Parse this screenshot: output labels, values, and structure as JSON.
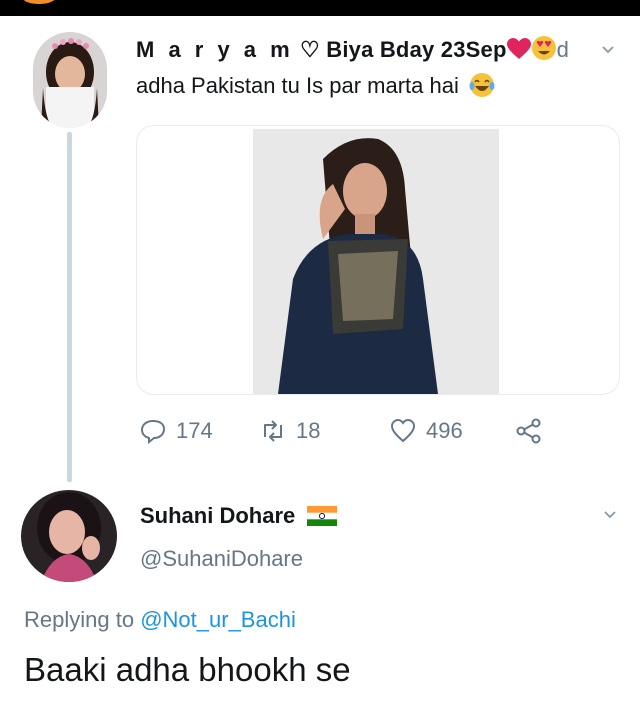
{
  "tweet": {
    "author_spaced": "M a r y a m",
    "author_rest": "♡ Biya Bday 23Sep",
    "date_suffix": "d",
    "text": "adha Pakistan tu Is par marta hai",
    "media": {
      "description": "photo"
    },
    "actions": {
      "reply_count": "174",
      "retweet_count": "18",
      "like_count": "496"
    }
  },
  "reply": {
    "display_name": "Suhani Dohare",
    "handle": "@SuhaniDohare",
    "replying_prefix": "Replying to",
    "replying_to": "@Not_ur_Bachi",
    "text": "Baaki adha bhookh se"
  },
  "icons": {
    "reply": "reply-icon",
    "retweet": "retweet-icon",
    "like": "heart-icon",
    "share": "share-icon",
    "more": "chevron-down-icon"
  },
  "colors": {
    "text": "#14171a",
    "muted": "#657786",
    "link": "#1b95e0",
    "heart_emoji": "#e0245e"
  }
}
